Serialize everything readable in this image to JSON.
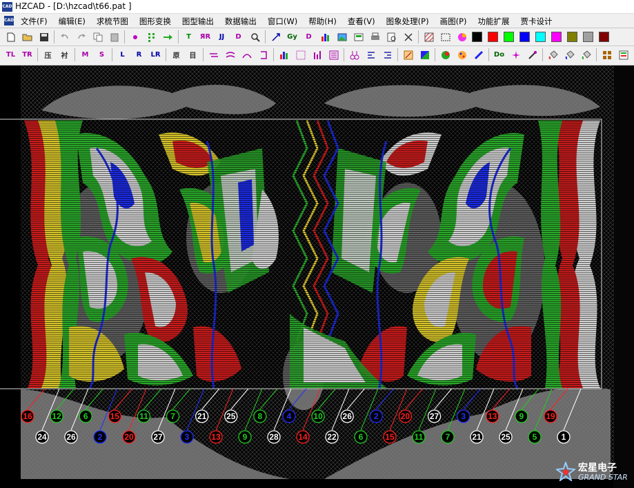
{
  "window": {
    "app_icon_text": "CAD",
    "title": "HZCAD - [D:\\hzcad\\t66.pat ]"
  },
  "menu": [
    "文件(F)",
    "编辑(E)",
    "求梳节图",
    "图形变换",
    "图型输出",
    "数据输出",
    "窗口(W)",
    "帮助(H)",
    "查看(V)",
    "图象处理(P)",
    "画图(P)",
    "功能扩展",
    "贾卡设计"
  ],
  "toolbar1": {
    "icons": [
      "new-file",
      "open-folder",
      "save",
      "undo",
      "redo",
      "copy",
      "paste",
      "dot",
      "grid",
      "arrow",
      "TT",
      "RR",
      "JJ",
      "DD",
      "zoom",
      "resize",
      "Gy",
      "D",
      "bars",
      "image",
      "print",
      "preview",
      "fit",
      "pattern",
      "select"
    ],
    "labels": {
      "TT": "T",
      "RR": "ЯR",
      "JJ": "JJ",
      "DD": "D",
      "Gy": "Gy",
      "D": "D"
    },
    "palette": [
      "#000000",
      "#ff0000",
      "#00ff00",
      "#0000ff",
      "#00ffff",
      "#ff00ff",
      "#808000",
      "#a0a0a0",
      "#800000"
    ]
  },
  "toolbar2": {
    "labels": [
      "TL",
      "TR",
      "压",
      "衬",
      "M",
      "S",
      "L",
      "R",
      "LR",
      "原",
      "目"
    ]
  },
  "guide_numbers_top": [
    "16",
    "12",
    "6",
    "15",
    "11",
    "7",
    "21",
    "25",
    "8",
    "4",
    "10",
    "26",
    "2",
    "20",
    "27",
    "3",
    "13",
    "9",
    "19"
  ],
  "guide_numbers_bottom": [
    "24",
    "26",
    "2",
    "20",
    "27",
    "3",
    "13",
    "9",
    "28",
    "14",
    "22",
    "6",
    "15",
    "11",
    "7",
    "21",
    "25",
    "5",
    "1"
  ],
  "guide_colors": {
    "1": "#ffffff",
    "2": "#2030ff",
    "3": "#2030ff",
    "4": "#2030ff",
    "5": "#22cc22",
    "6": "#22cc22",
    "7": "#22cc22",
    "8": "#22cc22",
    "9": "#22cc22",
    "10": "#22cc22",
    "11": "#22cc22",
    "12": "#22cc22",
    "13": "#ff2020",
    "14": "#ff2020",
    "15": "#ff2020",
    "16": "#ff2020",
    "19": "#ff2020",
    "20": "#ff2020",
    "21": "#ffffff",
    "22": "#ffffff",
    "24": "#ffffff",
    "25": "#ffffff",
    "26": "#ffffff",
    "27": "#ffffff",
    "28": "#ffffff"
  },
  "logo": {
    "cn": "宏星电子",
    "en": "GRAND STAR"
  }
}
